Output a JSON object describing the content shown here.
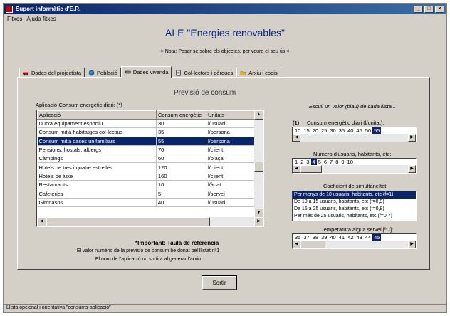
{
  "window": {
    "title": "Suport informàtic d'E.R.",
    "minimize": "_",
    "maximize": "□",
    "close": "×"
  },
  "menu": [
    "Fitxes",
    "Ajuda fitxes"
  ],
  "heading": "ALE \"Energies renovables\"",
  "note": "-> Nota: Posar-se sobre els objectes, per veure el seu ús <-",
  "tabs": [
    {
      "label": "Dades del projectista",
      "icon": "car-icon"
    },
    {
      "label": "Població",
      "icon": "globe-icon"
    },
    {
      "label": "Dades vivenda",
      "icon": "keyboard-icon",
      "active": true
    },
    {
      "label": "Col·lectors i pèrdues",
      "icon": "document-icon"
    },
    {
      "label": "Arxiu i codis",
      "icon": "folder-icon"
    }
  ],
  "section_title": "Previsió de consum",
  "table": {
    "caption": "Aplicació-Consum energètic diari: (*)",
    "headers": [
      "Aplicació",
      "Consum energètic",
      "Unitats"
    ],
    "rows": [
      [
        "Dutxa equipament esportiu",
        "30",
        "l/usuari"
      ],
      [
        "Consum mitjà habitatges col·lectius",
        "35",
        "l/persona"
      ],
      [
        "Consum mitjà cases unifamiliars",
        "55",
        "l/persona"
      ],
      [
        "Pensions, hostals, albergs",
        "70",
        "l/client"
      ],
      [
        "Càmpings",
        "60",
        "l/plaça"
      ],
      [
        "Hotels de tres i quatre estrelles",
        "120",
        "l/client"
      ],
      [
        "Hotels de luxe",
        "160",
        "l/client"
      ],
      [
        "Restaurants",
        "10",
        "l/àpat"
      ],
      [
        "Cafeteries",
        "5",
        "l/servei"
      ],
      [
        "Gimnasos",
        "40",
        "l/usuari"
      ]
    ],
    "selected_row": 2
  },
  "important": {
    "title": "*Important: Taula de referencia",
    "line1": "El valor numèric de la previsió de consum be donat pel llistat nº1",
    "line2": "El nom de l'aplicació no sortira al generar l'arxiu"
  },
  "right": {
    "hint": "Escull un valor (blau) de cada llista...",
    "consum_marker": "(1)",
    "consum_label": "Consum energètic diari (l/unitat):",
    "consum_values": [
      "10",
      "15",
      "20",
      "25",
      "30",
      "35",
      "40",
      "45",
      "50",
      "55"
    ],
    "consum_selected": 9,
    "usuaris_label": "Numero d'usuaris, habitants, etc:",
    "usuaris_values": [
      "1",
      "2",
      "3",
      "4",
      "5",
      "6",
      "7",
      "8",
      "9",
      "10"
    ],
    "usuaris_selected": 3,
    "coef_label": "Coeficient de simultaneïtat:",
    "coef_items": [
      "Per menys de 10 usuaris, habitants, etc (f=1)",
      "De 10 a 15 usuaris, habitants, etc (f=0,9)",
      "De 15 a 25 usuaris, habitants, etc (f=0,8)",
      "Per més de 25 usuaris, habitants, etc (f=0,7)"
    ],
    "coef_selected": 0,
    "temp_label": "Temperatura aigua servei [ºC]:",
    "temp_values": [
      "35",
      "37",
      "38",
      "39",
      "40",
      "41",
      "42",
      "43",
      "44",
      "45"
    ],
    "temp_selected": 9
  },
  "sortir": "Sortir",
  "status": "Llista opcional i orientativa \"consums-aplicació\""
}
